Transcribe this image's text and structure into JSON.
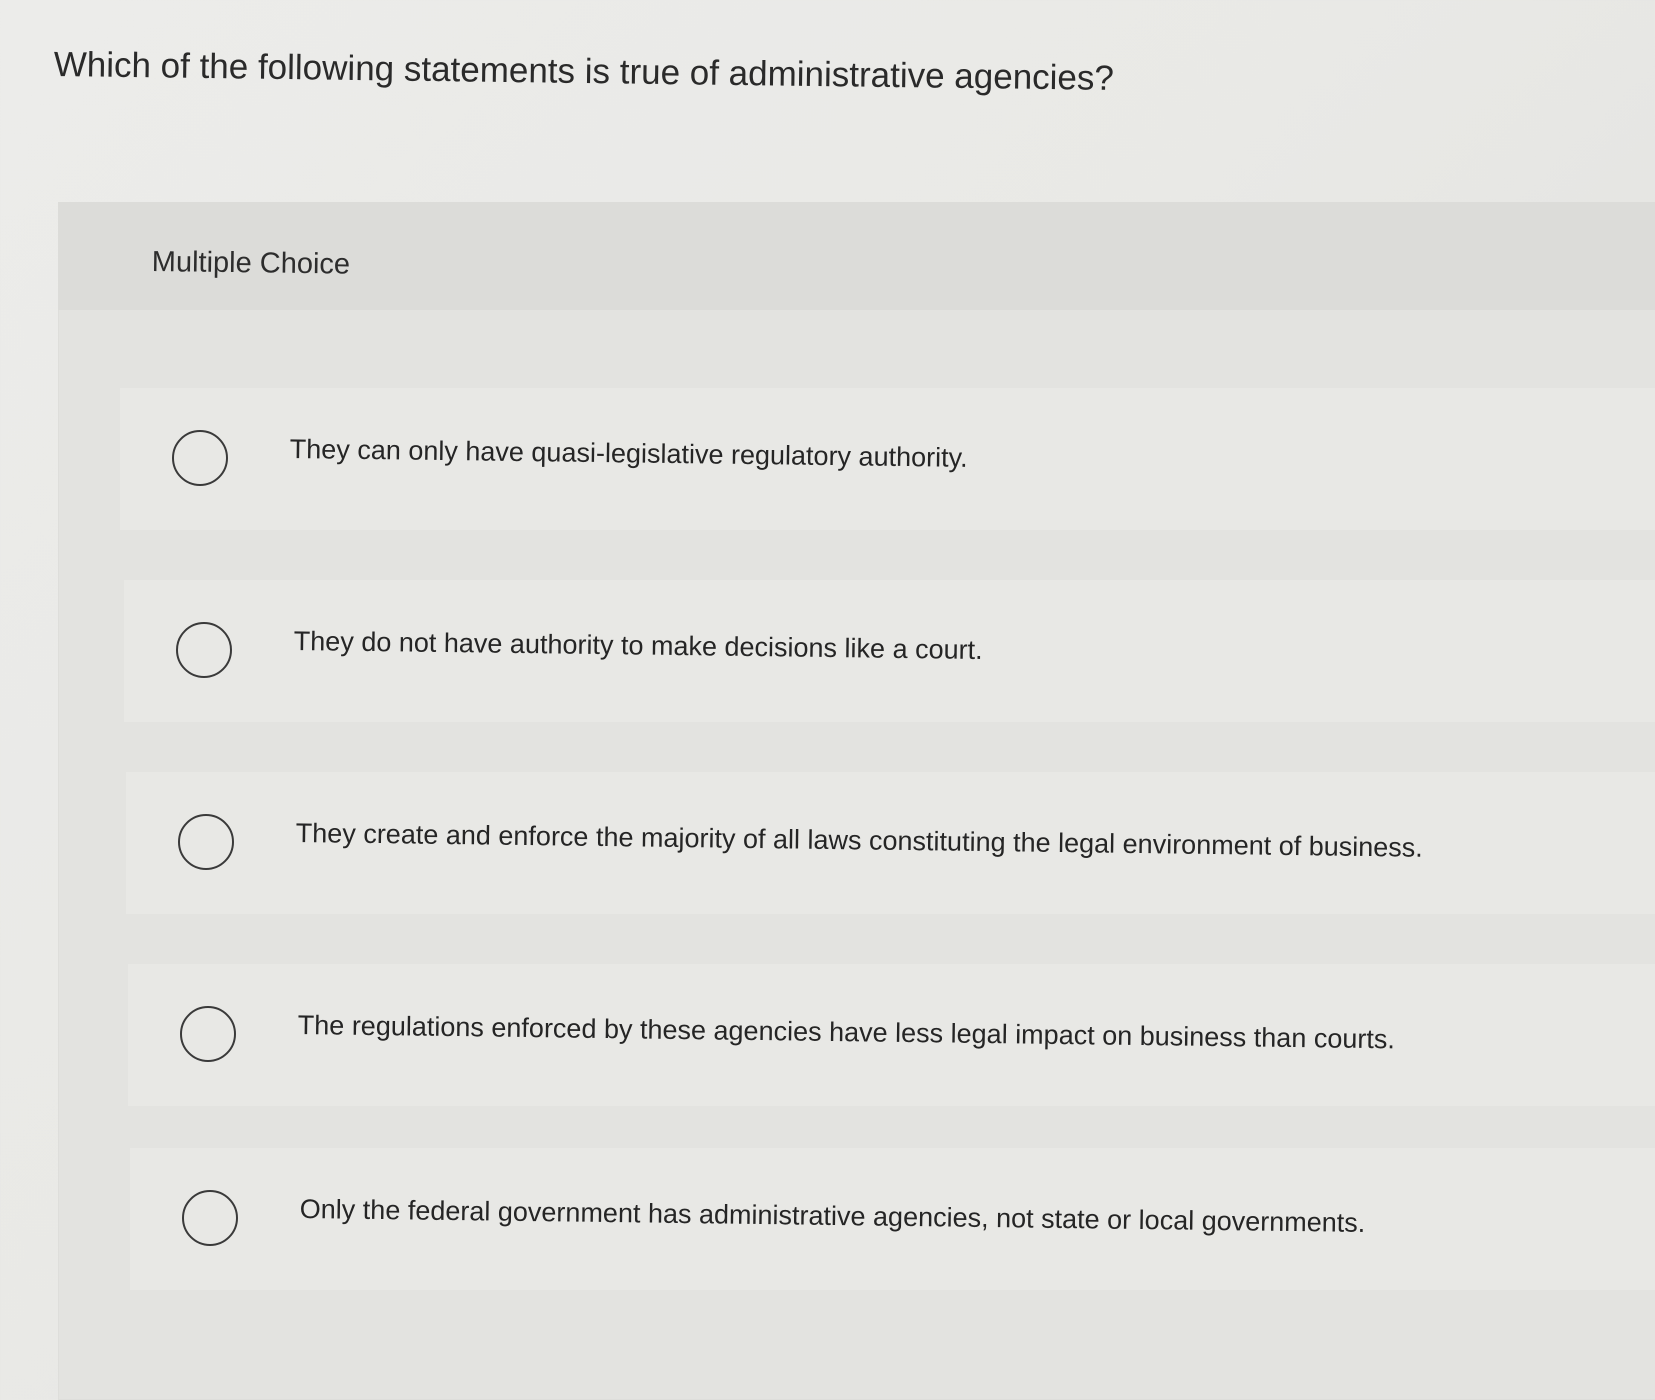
{
  "question": {
    "text": "Which of the following statements is true of administrative agencies?"
  },
  "multiple_choice": {
    "label": "Multiple Choice",
    "options": [
      {
        "label": "They can only have quasi-legislative regulatory authority.",
        "selected": false
      },
      {
        "label": "They do not have authority to make decisions like a court.",
        "selected": false
      },
      {
        "label": "They create and enforce the majority of all laws constituting the legal environment of business.",
        "selected": false
      },
      {
        "label": "The regulations enforced by these agencies have less legal impact on business than courts.",
        "selected": false
      },
      {
        "label": "Only the federal government has administrative agencies, not state or local governments.",
        "selected": false
      }
    ]
  },
  "colors": {
    "background": "#ececea",
    "panel": "#e3e3e0",
    "header": "#dcdcd9",
    "option_background": "#e8e8e5",
    "text": "#2b2b2b",
    "radio_border": "#3a3a3a"
  }
}
